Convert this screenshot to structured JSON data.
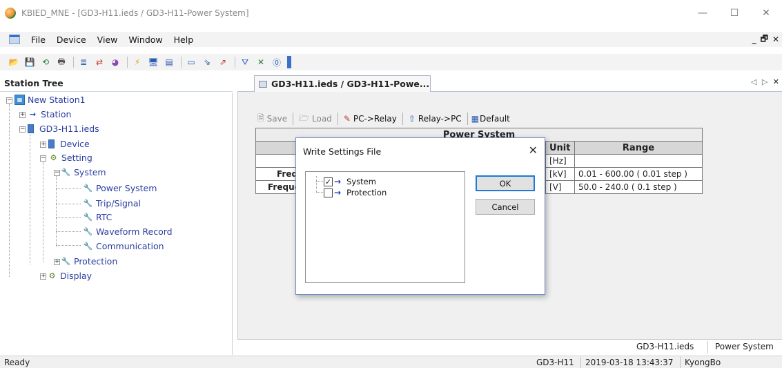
{
  "window": {
    "title": "KBIED_MNE - [GD3-H11.ieds / GD3-H11-Power System]",
    "minimize": "—",
    "maximize": "☐",
    "close": "✕"
  },
  "menu": {
    "items": [
      "File",
      "Device",
      "View",
      "Window",
      "Help"
    ],
    "mdi_minimize": "_",
    "mdi_restore": "🗗",
    "mdi_close": "✕"
  },
  "toolbar": {
    "icons": [
      "open-folder-icon",
      "save-icon",
      "refresh-icon",
      "print-icon",
      "tree-icon",
      "transfer-icon",
      "pie-icon",
      "connect-icon",
      "monitor-icon",
      "list-icon",
      "window-icon",
      "split-icon",
      "merge-icon",
      "filter-icon",
      "delete-icon",
      "about-icon"
    ],
    "glyphs": [
      "📂",
      "💾",
      "⟲",
      "🖶",
      "≣",
      "⇄",
      "◕",
      "⚡",
      "🖥",
      "▤",
      "▭",
      "⇘",
      "⇗",
      "⛛",
      "✕",
      "⓪"
    ]
  },
  "station_tree": {
    "header": "Station Tree",
    "root": "New Station1",
    "station": "Station",
    "ieds": "GD3-H11.ieds",
    "device": "Device",
    "setting": "Setting",
    "system": "System",
    "power_system": "Power System",
    "trip_signal": "Trip/Signal",
    "rtc": "RTC",
    "waveform_record": "Waveform Record",
    "communication": "Communication",
    "protection": "Protection",
    "display": "Display"
  },
  "document": {
    "tab_label": "GD3-H11.ieds / GD3-H11-Powe...",
    "arrows": "◁ ▷",
    "close": "✕"
  },
  "doc_toolbar": {
    "save": "Save",
    "load": "Load",
    "pc_to_relay": "PC->Relay",
    "relay_to_pc": "Relay->PC",
    "default": "Default"
  },
  "power_table": {
    "caption": "Power System",
    "col_unit": "Unit",
    "col_range": "Range",
    "rows": [
      {
        "name": "",
        "unit": "[Hz]",
        "range": ""
      },
      {
        "name": "Freq",
        "unit": "[kV]",
        "range": "0.01 - 600.00 ( 0.01 step )"
      },
      {
        "name": "Freque",
        "unit": "[V]",
        "range": "50.0 - 240.0 ( 0.1 step )"
      }
    ]
  },
  "dialog": {
    "title": "Write Settings File",
    "close": "✕",
    "items": [
      {
        "label": "System",
        "checked": true,
        "mark": "✓"
      },
      {
        "label": "Protection",
        "checked": false,
        "mark": ""
      }
    ],
    "ok": "OK",
    "cancel": "Cancel"
  },
  "doc_status": {
    "file": "GD3-H11.ieds",
    "page": "Power System"
  },
  "statusbar": {
    "ready": "Ready",
    "device": "GD3-H11",
    "datetime": "2019-03-18 13:43:37",
    "user": "KyongBo"
  },
  "colors": {
    "tree_text": "#2a3ea0",
    "accent_blue": "#1c3fb5",
    "dialog_border": "#6a8fc7"
  }
}
